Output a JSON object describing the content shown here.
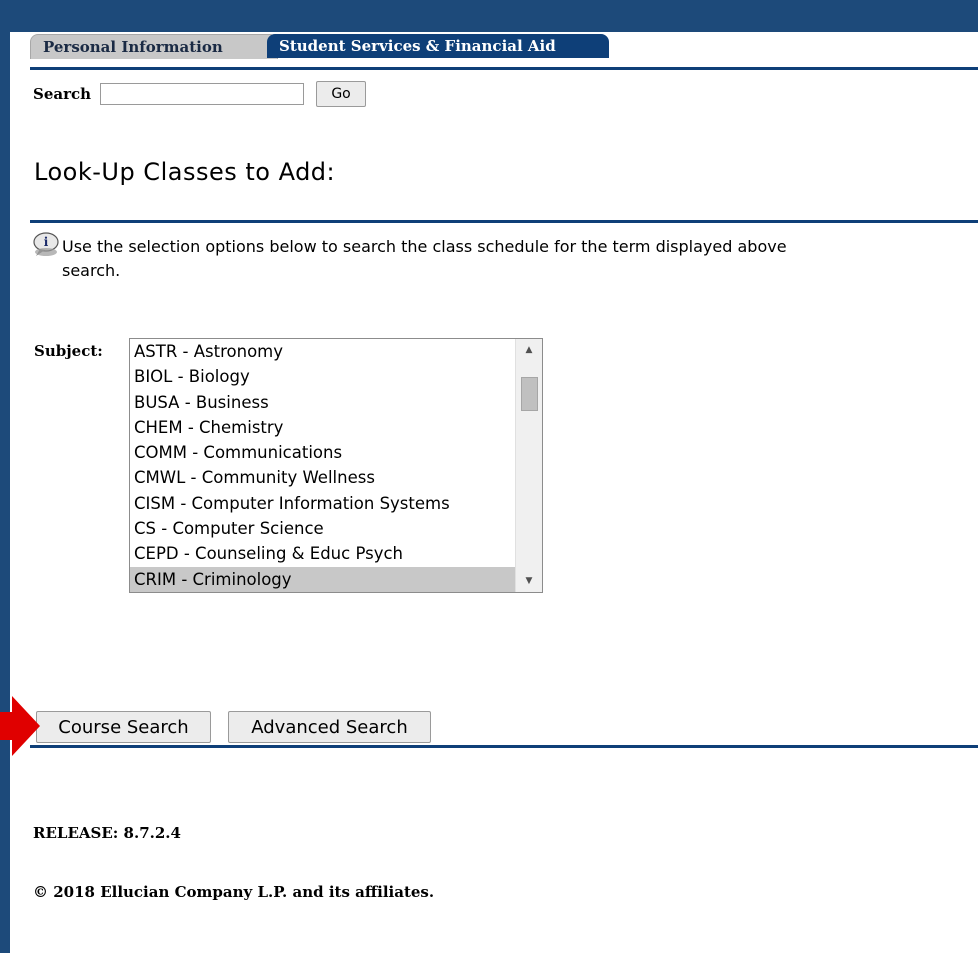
{
  "tabs": [
    {
      "label": "Personal Information",
      "active": false
    },
    {
      "label": "Student Services & Financial Aid",
      "active": true
    }
  ],
  "search": {
    "label": "Search",
    "value": "",
    "placeholder": "",
    "go_label": "Go"
  },
  "page_title": "Look-Up Classes to Add:",
  "info": {
    "icon": "info-speech-icon",
    "line1": "Use the selection options below to search the class schedule for the term displayed above",
    "line2": "search."
  },
  "subject": {
    "label": "Subject:",
    "options": [
      "ASTR - Astronomy",
      "BIOL - Biology",
      "BUSA - Business",
      "CHEM - Chemistry",
      "COMM - Communications",
      "CMWL - Community Wellness",
      "CISM - Computer Information Systems",
      "CS - Computer Science",
      "CEPD - Counseling & Educ Psych",
      "CRIM - Criminology"
    ],
    "selected": "CRIM - Criminology"
  },
  "buttons": {
    "course_search": "Course Search",
    "advanced_search": "Advanced Search"
  },
  "footer": {
    "release": "RELEASE: 8.7.2.4",
    "copyright": "© 2018 Ellucian Company L.P. and its affiliates."
  },
  "colors": {
    "frame": "#1d4a7a",
    "rule": "#0e3f78",
    "active_tab": "#0e3f78",
    "inactive_tab": "#c8c8c8",
    "arrow": "#e00000",
    "selected_option": "#c8c8c8"
  }
}
